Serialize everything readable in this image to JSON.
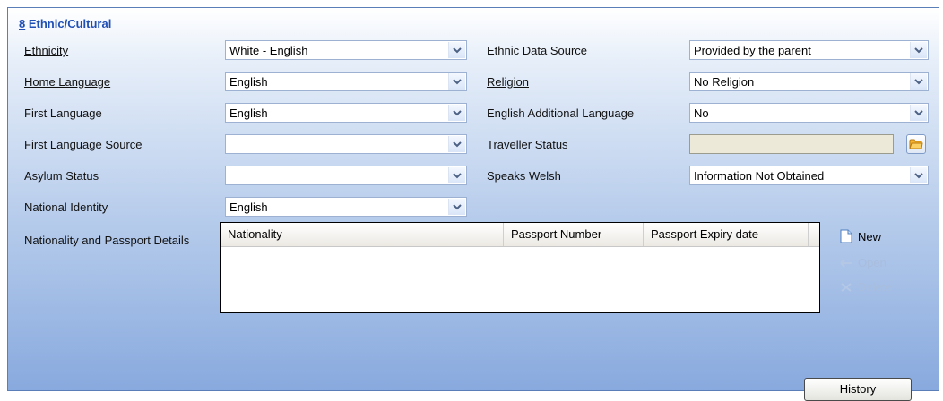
{
  "section": {
    "number": "8",
    "title": "Ethnic/Cultural"
  },
  "left_fields": [
    {
      "label": "Ethnicity",
      "value": "White - English"
    },
    {
      "label": "Home Language",
      "value": "English"
    },
    {
      "label": "First Language",
      "value": "English"
    },
    {
      "label": "First Language Source",
      "value": ""
    },
    {
      "label": "Asylum Status",
      "value": ""
    },
    {
      "label": "National Identity",
      "value": "English"
    }
  ],
  "right_fields": [
    {
      "label": "Ethnic Data Source",
      "value": "Provided by the parent"
    },
    {
      "label": "Religion",
      "value": "No Religion"
    },
    {
      "label": "English Additional Language",
      "value": "No"
    },
    {
      "label": "Traveller Status",
      "value": ""
    },
    {
      "label": "Speaks Welsh",
      "value": "Information Not Obtained"
    }
  ],
  "passport": {
    "label": "Nationality and Passport Details",
    "columns": [
      "Nationality",
      "Passport Number",
      "Passport Expiry date"
    ],
    "rows": []
  },
  "actions": {
    "new_label": "New",
    "open_label": "Open",
    "delete_label": "Delete"
  },
  "history_label": "History",
  "colors": {
    "accent": "#1f4fb5",
    "panel_bottom": "#88a9de",
    "disabled_field": "#ece9d8"
  },
  "icons": [
    "chevron-down-icon",
    "folder-icon",
    "new-document-icon",
    "open-icon",
    "delete-icon"
  ]
}
